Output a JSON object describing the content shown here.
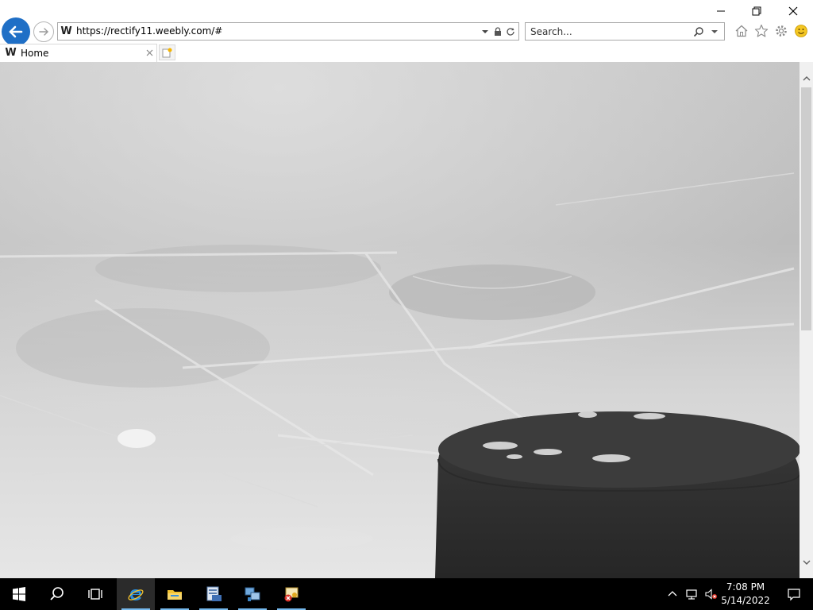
{
  "window": {
    "controls": [
      "minimize",
      "restore",
      "close"
    ]
  },
  "address_bar": {
    "url": "https://rectify11.weebly.com/#",
    "site_icon_letter": "W"
  },
  "search": {
    "placeholder": "Search..."
  },
  "toolbar_icons": [
    "home-icon",
    "favorites-star-icon",
    "settings-gear-icon",
    "feedback-smiley-icon"
  ],
  "tabs": [
    {
      "title": "Home",
      "site_icon_letter": "W"
    }
  ],
  "page": {
    "hero_image": "ice-rink-with-hockey-puck"
  },
  "taskbar": {
    "pinned": [
      "start-icon",
      "search-icon",
      "task-view-icon",
      "internet-explorer-icon",
      "file-explorer-icon",
      "server-manager-icon",
      "network-settings-icon",
      "certificate-error-icon"
    ],
    "active_app": "internet-explorer-icon",
    "tray_icons": [
      "tray-chevron-icon",
      "network-icon",
      "volume-muted-icon"
    ],
    "clock": {
      "time": "7:08 PM",
      "date": "5/14/2022"
    }
  },
  "colors": {
    "accent": "#1f6fc6",
    "taskbar": "#000000",
    "taskbar_active_underline": "#76b9ed"
  }
}
